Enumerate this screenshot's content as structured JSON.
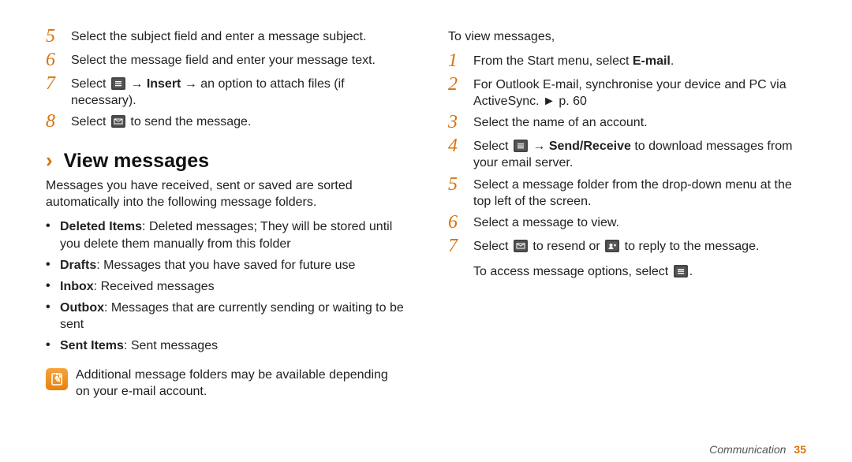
{
  "left": {
    "stepsA": [
      {
        "n": "5",
        "text": "Select the subject field and enter a message subject."
      },
      {
        "n": "6",
        "text": "Select the message field and enter your message text."
      },
      {
        "n": "7",
        "pre": "Select ",
        "icon": "menu",
        "mid": " → ",
        "bold": "Insert",
        "post": " → an option to attach files (if necessary)."
      },
      {
        "n": "8",
        "pre": "Select ",
        "icon": "send",
        "post": " to send the message."
      }
    ],
    "sectionTitle": "View messages",
    "intro": "Messages you have received, sent or saved are sorted automatically into the following message folders.",
    "bullets": [
      {
        "bold": "Deleted Items",
        "text": ": Deleted messages; They will be stored until you delete them manually from this folder"
      },
      {
        "bold": "Drafts",
        "text": ": Messages that you have saved for future use"
      },
      {
        "bold": "Inbox",
        "text": ": Received messages"
      },
      {
        "bold": "Outbox",
        "text": ": Messages that are currently sending or waiting to be sent"
      },
      {
        "bold": "Sent Items",
        "text": ": Sent messages"
      }
    ],
    "note": "Additional message folders may be available depending on your e-mail account."
  },
  "right": {
    "lead": "To view messages,",
    "steps": [
      {
        "n": "1",
        "pre": "From the Start menu, select ",
        "bold": "E-mail",
        "post": "."
      },
      {
        "n": "2",
        "text": "For Outlook E-mail, synchronise your device and PC via ActiveSync. ► p. 60"
      },
      {
        "n": "3",
        "text": "Select the name of an account."
      },
      {
        "n": "4",
        "pre": "Select ",
        "icon": "menu",
        "mid": " → ",
        "bold": "Send/Receive",
        "post": " to download messages from your email server."
      },
      {
        "n": "5",
        "text": "Select a message folder from the drop-down menu at the top left of the screen."
      },
      {
        "n": "6",
        "text": "Select a message to view."
      },
      {
        "n": "7",
        "pre": "Select ",
        "icon": "send",
        "mid": " to resend or ",
        "icon2": "reply",
        "post": " to reply to the message."
      }
    ],
    "tail": {
      "pre": "To access message options, select ",
      "icon": "menu",
      "post": "."
    }
  },
  "footer": {
    "section": "Communication",
    "page": "35"
  }
}
